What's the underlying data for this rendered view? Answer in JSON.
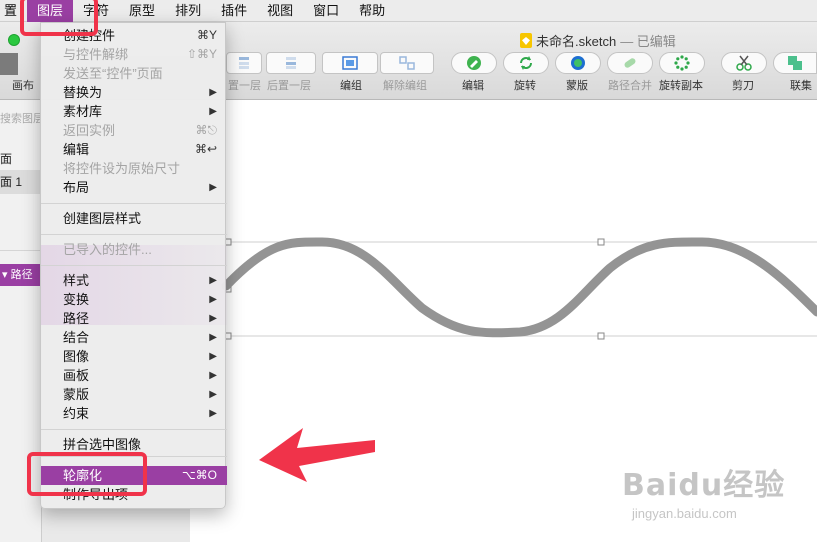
{
  "menubar": {
    "items": [
      {
        "label": "置"
      },
      {
        "label": "图层"
      },
      {
        "label": "字符"
      },
      {
        "label": "原型"
      },
      {
        "label": "排列"
      },
      {
        "label": "插件"
      },
      {
        "label": "视图"
      },
      {
        "label": "窗口"
      },
      {
        "label": "帮助"
      }
    ]
  },
  "window": {
    "title": "未命名.sketch",
    "status": " — 已编辑"
  },
  "toolbar": {
    "items": [
      {
        "label": "置一层",
        "enabled": false,
        "icon": "forward-icon"
      },
      {
        "label": "后置一层",
        "enabled": false,
        "icon": "backward-icon"
      },
      {
        "label": "编组",
        "enabled": true,
        "icon": "group-icon"
      },
      {
        "label": "解除编组",
        "enabled": false,
        "icon": "ungroup-icon"
      },
      {
        "label": "编辑",
        "enabled": true,
        "icon": "edit-icon"
      },
      {
        "label": "旋转",
        "enabled": true,
        "icon": "rotate-icon"
      },
      {
        "label": "蒙版",
        "enabled": true,
        "icon": "mask-icon"
      },
      {
        "label": "路径合并",
        "enabled": false,
        "icon": "path-join-icon"
      },
      {
        "label": "旋转副本",
        "enabled": true,
        "icon": "rotate-copies-icon"
      },
      {
        "label": "剪刀",
        "enabled": true,
        "icon": "scissors-icon"
      },
      {
        "label": "联集",
        "enabled": true,
        "icon": "union-icon"
      }
    ]
  },
  "sidebar": {
    "canvas_label": "画布",
    "search_placeholder": "搜索图层",
    "page_item": "面",
    "page_item_2": "面 1",
    "layer_item": "路径"
  },
  "menu": {
    "items": [
      {
        "label": "创建控件",
        "shortcut": "⌘Y",
        "enabled": true,
        "submenu": false
      },
      {
        "label": "与控件解绑",
        "shortcut": "⇧⌘Y",
        "enabled": false,
        "submenu": false
      },
      {
        "label": "发送至“控件”页面",
        "shortcut": "",
        "enabled": false,
        "submenu": false
      },
      {
        "label": "替换为",
        "shortcut": "",
        "enabled": true,
        "submenu": true
      },
      {
        "label": "素材库",
        "shortcut": "",
        "enabled": true,
        "submenu": true
      },
      {
        "label": "返回实例",
        "shortcut": "⌘⎋",
        "enabled": false,
        "submenu": false
      },
      {
        "label": "编辑",
        "shortcut": "⌘↩",
        "enabled": true,
        "submenu": false
      },
      {
        "label": "将控件设为原始尺寸",
        "shortcut": "",
        "enabled": false,
        "submenu": false
      },
      {
        "label": "布局",
        "shortcut": "",
        "enabled": true,
        "submenu": true
      },
      {
        "label": "创建图层样式",
        "shortcut": "",
        "enabled": true,
        "submenu": false
      },
      {
        "label": "已导入的控件...",
        "shortcut": "",
        "enabled": false,
        "submenu": false
      },
      {
        "label": "样式",
        "shortcut": "",
        "enabled": true,
        "submenu": true
      },
      {
        "label": "变换",
        "shortcut": "",
        "enabled": true,
        "submenu": true
      },
      {
        "label": "路径",
        "shortcut": "",
        "enabled": true,
        "submenu": true
      },
      {
        "label": "结合",
        "shortcut": "",
        "enabled": true,
        "submenu": true
      },
      {
        "label": "图像",
        "shortcut": "",
        "enabled": true,
        "submenu": true
      },
      {
        "label": "画板",
        "shortcut": "",
        "enabled": true,
        "submenu": true
      },
      {
        "label": "蒙版",
        "shortcut": "",
        "enabled": true,
        "submenu": true
      },
      {
        "label": "约束",
        "shortcut": "",
        "enabled": true,
        "submenu": true
      },
      {
        "label": "拼合选中图像",
        "shortcut": "",
        "enabled": true,
        "submenu": false
      },
      {
        "label": "轮廓化",
        "shortcut": "⌥⌘O",
        "enabled": true,
        "submenu": false,
        "highlighted": true
      },
      {
        "label": "制作导出项",
        "shortcut": "",
        "enabled": true,
        "submenu": false
      }
    ],
    "submenu_arrow": "▶"
  },
  "watermark": {
    "brand": "Baidu经验",
    "site": "jingyan.baidu.com"
  },
  "colors": {
    "accent": "#9a3fa3",
    "annotation_red": "#f0334a",
    "wave_stroke": "#949494"
  }
}
